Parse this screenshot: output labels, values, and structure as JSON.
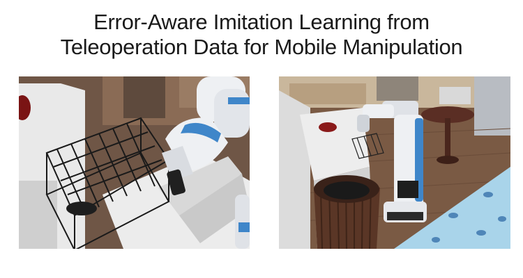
{
  "title": {
    "line1": "Error-Aware Imitation Learning from",
    "line2": "Teleoperation Data for Mobile Manipulation"
  },
  "colors": {
    "background": "#ffffff",
    "title_text": "#1a1a1a",
    "robot_blue": "#3f86c9",
    "robot_white": "#eef0f3",
    "wood_floor": "#7a5a44",
    "rug_blue": "#a9d4ea"
  }
}
